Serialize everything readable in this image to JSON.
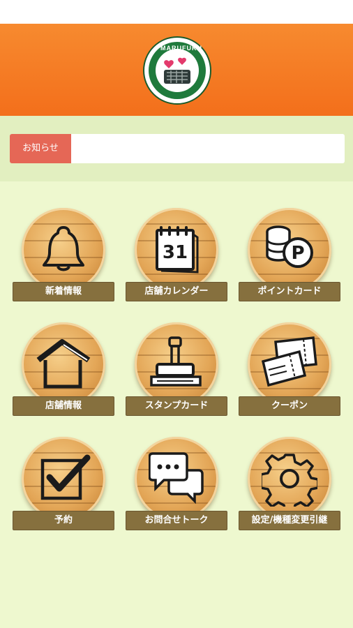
{
  "header": {
    "brand": "MARUFUKU"
  },
  "notice": {
    "label": "お知らせ",
    "text": ""
  },
  "menu": [
    {
      "label": "新着情報",
      "icon": "bell-icon"
    },
    {
      "label": "店舗カレンダー",
      "icon": "calendar-icon",
      "calendar_day": "31"
    },
    {
      "label": "ポイントカード",
      "icon": "coins-points-icon",
      "point_mark": "P"
    },
    {
      "label": "店舗情報",
      "icon": "house-icon"
    },
    {
      "label": "スタンプカード",
      "icon": "stamp-icon"
    },
    {
      "label": "クーポン",
      "icon": "coupon-tickets-icon"
    },
    {
      "label": "予約",
      "icon": "checkbox-icon"
    },
    {
      "label": "お問合せトーク",
      "icon": "chat-bubbles-icon"
    },
    {
      "label": "設定/機種変更引継",
      "icon": "gear-icon"
    }
  ]
}
